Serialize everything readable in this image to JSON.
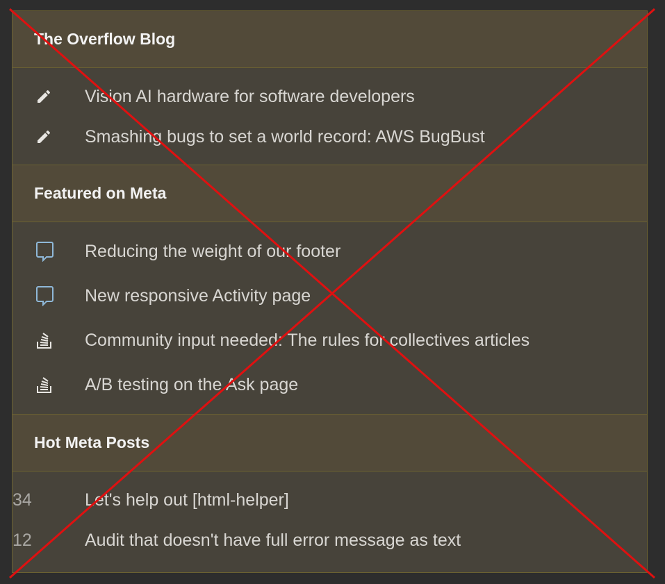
{
  "blog": {
    "title": "The Overflow Blog",
    "items": [
      {
        "label": "Vision AI hardware for software developers",
        "icon": "pencil-icon"
      },
      {
        "label": "Smashing bugs to set a world record: AWS BugBust",
        "icon": "pencil-icon"
      }
    ]
  },
  "meta": {
    "title": "Featured on Meta",
    "items": [
      {
        "label": "Reducing the weight of our footer",
        "icon": "speech-bubble-icon"
      },
      {
        "label": "New responsive Activity page",
        "icon": "speech-bubble-icon"
      },
      {
        "label": "Community input needed: The rules for collectives articles",
        "icon": "stack-exchange-icon"
      },
      {
        "label": "A/B testing on the Ask page",
        "icon": "stack-exchange-icon"
      }
    ]
  },
  "hot": {
    "title": "Hot Meta Posts",
    "items": [
      {
        "score": "34",
        "label": "Let's help out [html-helper]"
      },
      {
        "score": "12",
        "label": "Audit that doesn't have full error message as text"
      }
    ]
  },
  "colors": {
    "header_bg": "#524a39",
    "body_bg": "#47433a",
    "border": "#6b6132",
    "bubble_icon": "#8fb8d8",
    "cross_out": "#e01010"
  }
}
